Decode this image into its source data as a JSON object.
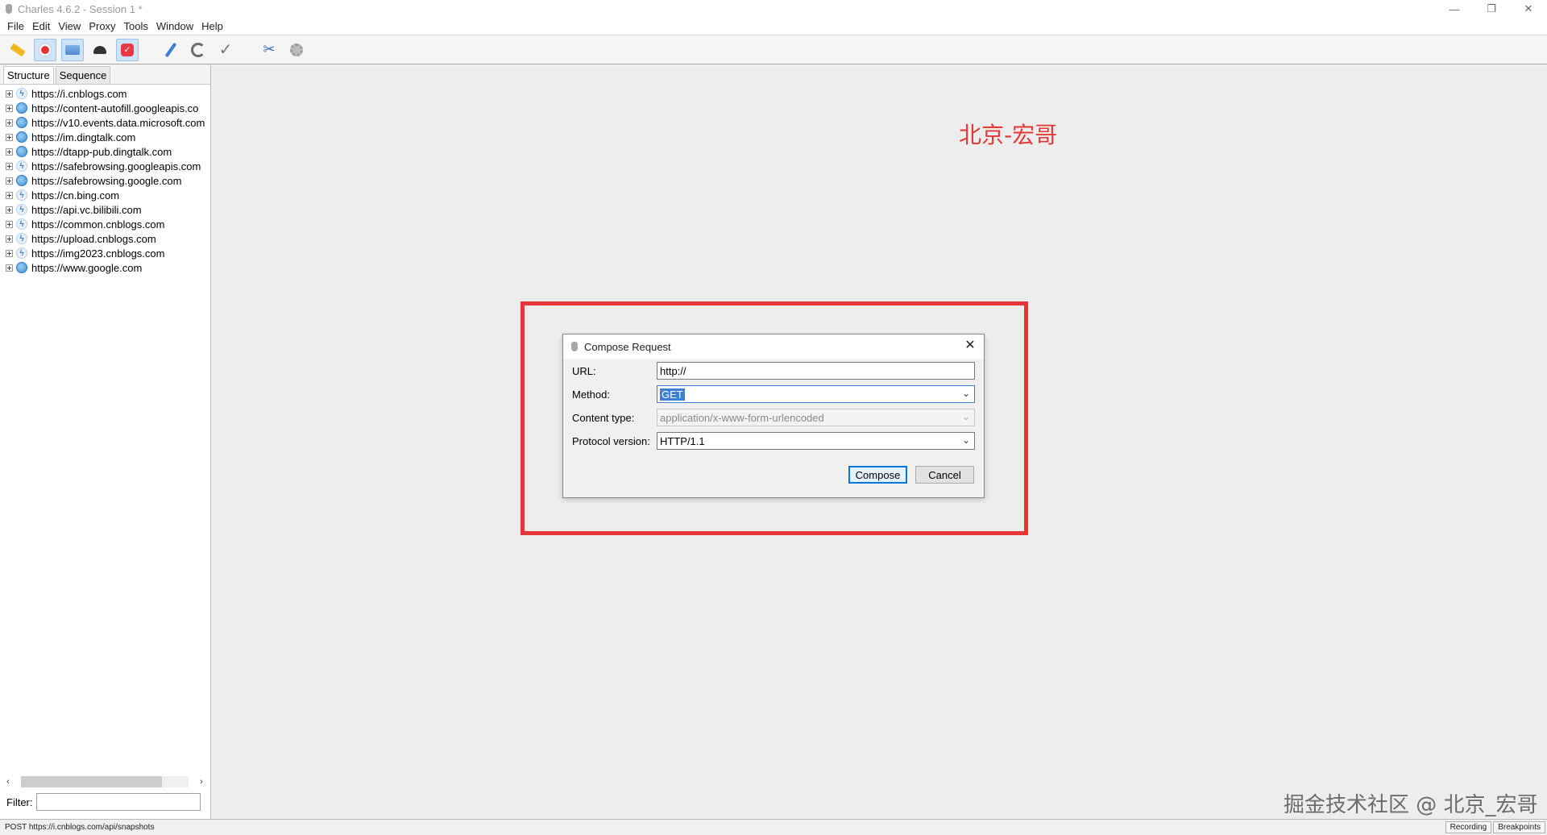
{
  "window": {
    "title": "Charles 4.6.2 - Session 1 *",
    "controls": [
      "—",
      "❐",
      "✕"
    ]
  },
  "menu": [
    "File",
    "Edit",
    "View",
    "Proxy",
    "Tools",
    "Window",
    "Help"
  ],
  "toolbar": {
    "items": [
      "broom-icon",
      "record-icon",
      "throttle-icon",
      "turtle-icon",
      "breakpoint-icon",
      "compose-pen-icon",
      "refresh-icon",
      "validate-check-icon",
      "tools-icon",
      "settings-gear-icon"
    ]
  },
  "sidebar": {
    "tabs": [
      "Structure",
      "Sequence"
    ],
    "hosts": [
      {
        "label": "https://i.cnblogs.com",
        "icon": "bolt"
      },
      {
        "label": "https://content-autofill.googleapis.co",
        "icon": "globe"
      },
      {
        "label": "https://v10.events.data.microsoft.com",
        "icon": "globe"
      },
      {
        "label": "https://im.dingtalk.com",
        "icon": "globe"
      },
      {
        "label": "https://dtapp-pub.dingtalk.com",
        "icon": "globe"
      },
      {
        "label": "https://safebrowsing.googleapis.com",
        "icon": "bolt"
      },
      {
        "label": "https://safebrowsing.google.com",
        "icon": "globe"
      },
      {
        "label": "https://cn.bing.com",
        "icon": "bolt"
      },
      {
        "label": "https://api.vc.bilibili.com",
        "icon": "bolt"
      },
      {
        "label": "https://common.cnblogs.com",
        "icon": "bolt"
      },
      {
        "label": "https://upload.cnblogs.com",
        "icon": "bolt"
      },
      {
        "label": "https://img2023.cnblogs.com",
        "icon": "bolt"
      },
      {
        "label": "https://www.google.com",
        "icon": "globe"
      }
    ],
    "filter_label": "Filter:",
    "filter_value": ""
  },
  "main": {
    "watermark_text": "北京-宏哥",
    "highlight_color": "#e8353a"
  },
  "dialog": {
    "title": "Compose Request",
    "url_label": "URL:",
    "url_value": "http://",
    "method_label": "Method:",
    "method_value": "GET",
    "content_type_label": "Content type:",
    "content_type_value": "application/x-www-form-urlencoded",
    "protocol_label": "Protocol version:",
    "protocol_value": "HTTP/1.1",
    "compose_button": "Compose",
    "cancel_button": "Cancel"
  },
  "status": {
    "text": "POST https://i.cnblogs.com/api/snapshots",
    "recording": "Recording",
    "breakpoints": "Breakpoints"
  },
  "footer_watermark": "掘金技术社区 @ 北京_宏哥"
}
